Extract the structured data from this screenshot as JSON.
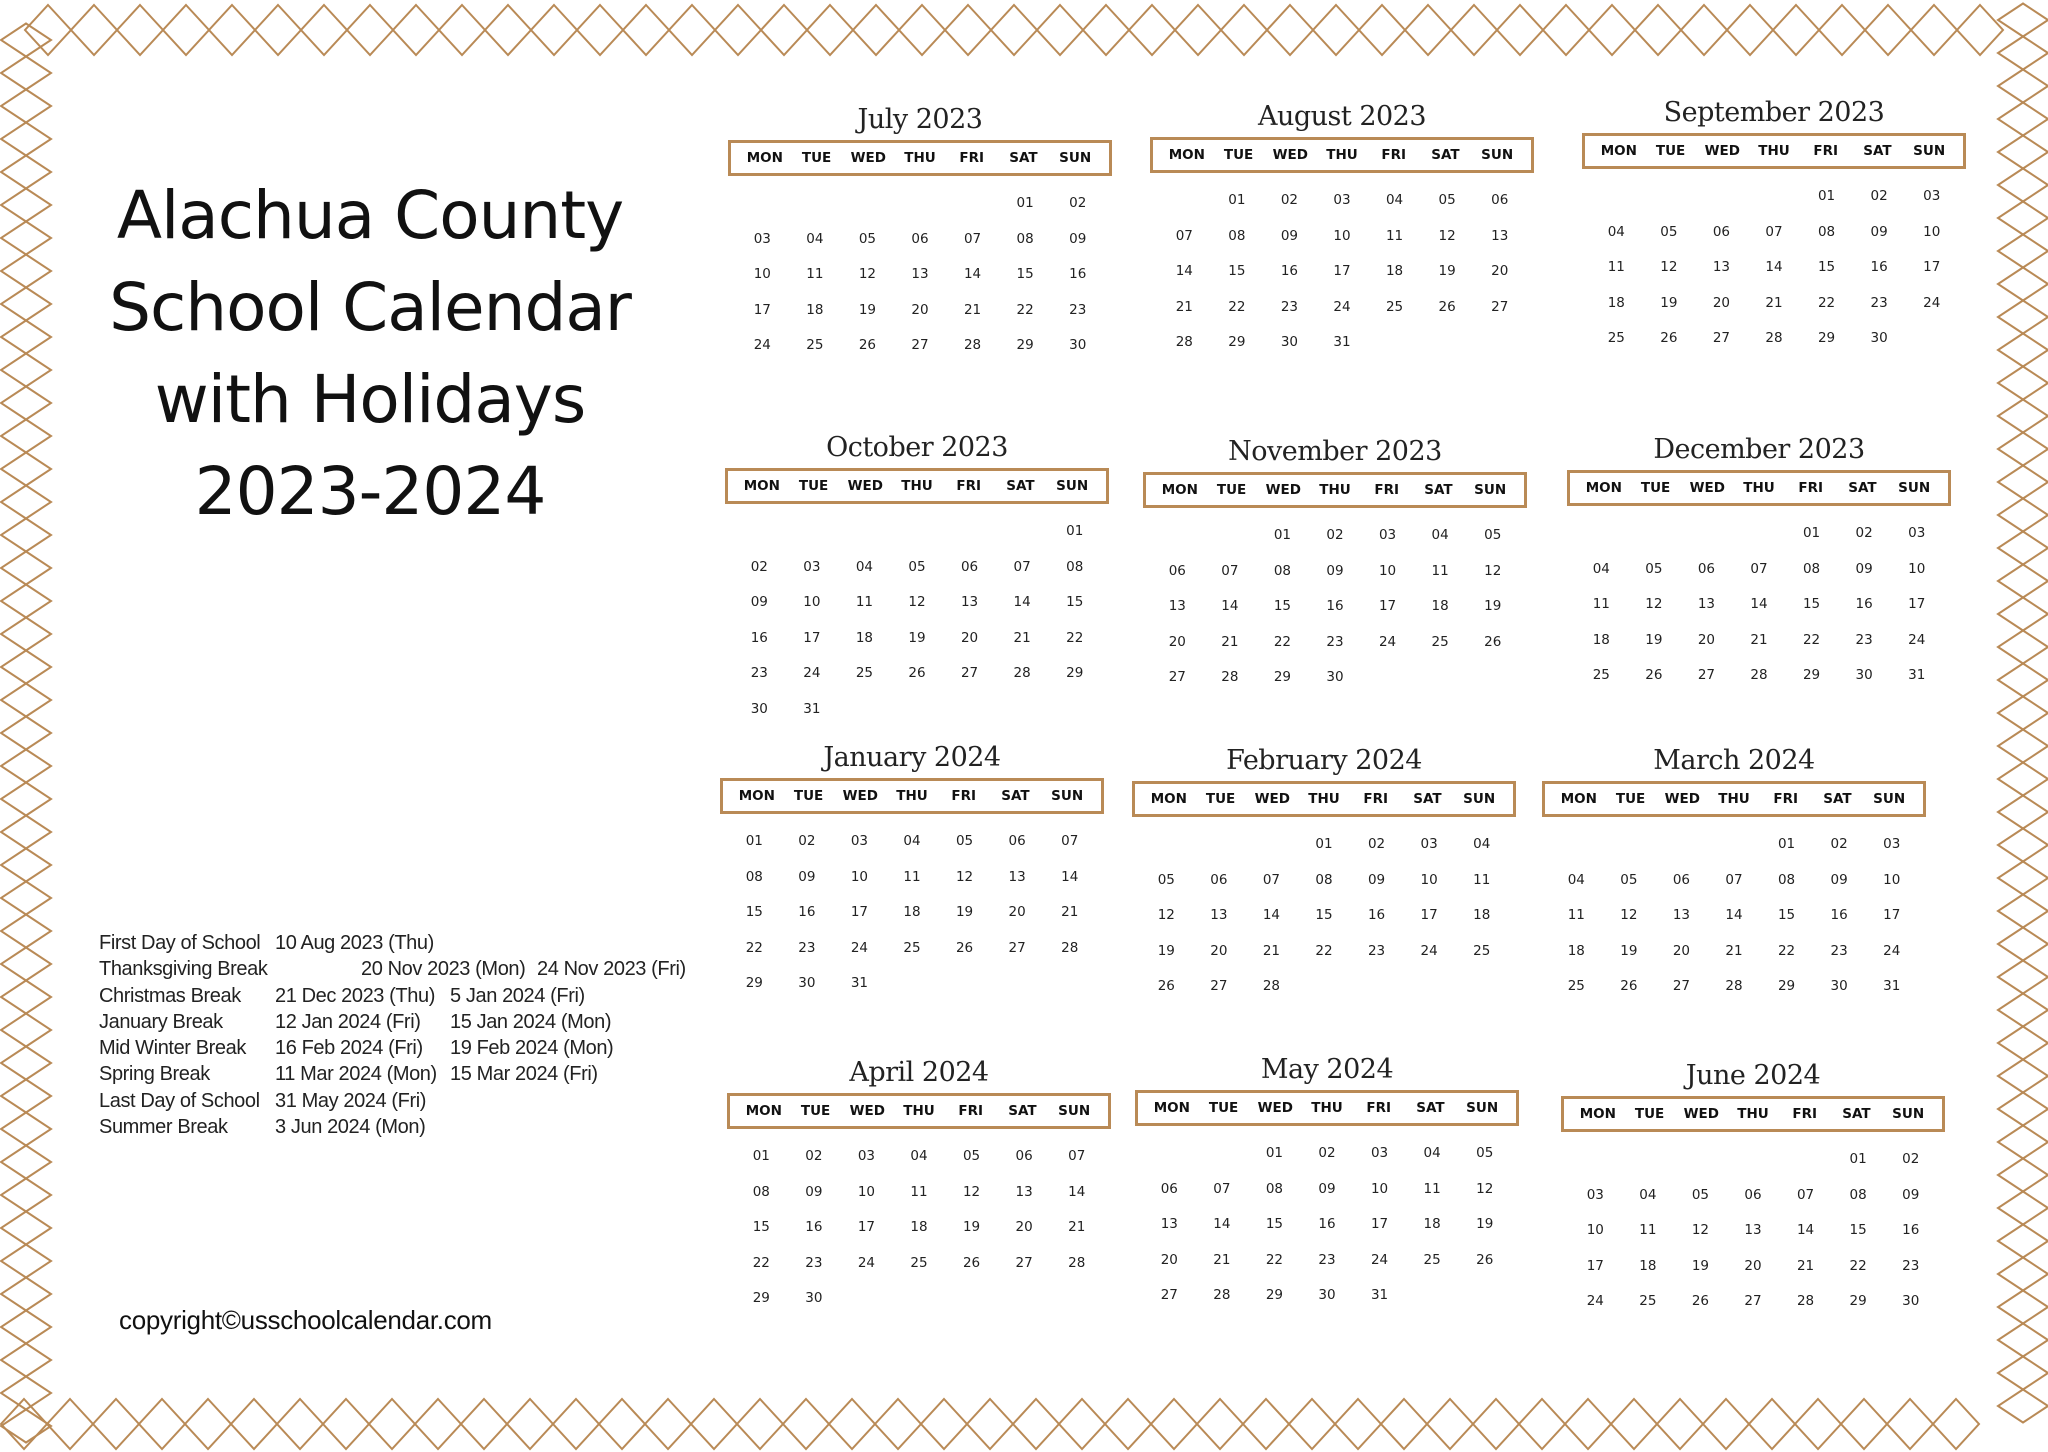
{
  "title_lines": [
    "Alachua County",
    "School Calendar",
    "with Holidays",
    "2023-2024"
  ],
  "weekdays": [
    "MON",
    "TUE",
    "WED",
    "THU",
    "FRI",
    "SAT",
    "SUN"
  ],
  "colors": {
    "accent": "#b98a56",
    "text": "#111111"
  },
  "holidays": [
    {
      "name": "First Day of School",
      "start": "10 Aug 2023 (Thu)",
      "end": ""
    },
    {
      "name": "Thanksgiving Break",
      "start": "20 Nov 2023 (Mon)",
      "end": "24 Nov 2023 (Fri)",
      "shift": true
    },
    {
      "name": "Christmas Break",
      "start": "21 Dec 2023 (Thu)",
      "end": "5 Jan 2024 (Fri)"
    },
    {
      "name": "January Break",
      "start": "12 Jan 2024 (Fri)",
      "end": "15 Jan 2024 (Mon)"
    },
    {
      "name": "Mid Winter Break",
      "start": "16 Feb 2024 (Fri)",
      "end": "19 Feb 2024 (Mon)"
    },
    {
      "name": "Spring Break",
      "start": "11 Mar 2024 (Mon)",
      "end": "15 Mar 2024 (Fri)"
    },
    {
      "name": "Last Day of School",
      "start": "31 May 2024 (Fri)",
      "end": ""
    },
    {
      "name": "Summer Break",
      "start": "3 Jun 2024 (Mon)",
      "end": ""
    }
  ],
  "copyright": "copyright©usschoolcalendar.com",
  "months": [
    {
      "name": "July 2023",
      "offset": 5,
      "days": 30
    },
    {
      "name": "August 2023",
      "offset": 1,
      "days": 31
    },
    {
      "name": "September 2023",
      "offset": 4,
      "days": 30
    },
    {
      "name": "October 2023",
      "offset": 6,
      "days": 31
    },
    {
      "name": "November 2023",
      "offset": 2,
      "days": 30
    },
    {
      "name": "December 2023",
      "offset": 4,
      "days": 31
    },
    {
      "name": "January 2024",
      "offset": 0,
      "days": 31
    },
    {
      "name": "February 2024",
      "offset": 3,
      "days": 28
    },
    {
      "name": "March 2024",
      "offset": 4,
      "days": 31
    },
    {
      "name": "April 2024",
      "offset": 0,
      "days": 30
    },
    {
      "name": "May 2024",
      "offset": 2,
      "days": 31
    },
    {
      "name": "June 2024",
      "offset": 5,
      "days": 30
    }
  ]
}
